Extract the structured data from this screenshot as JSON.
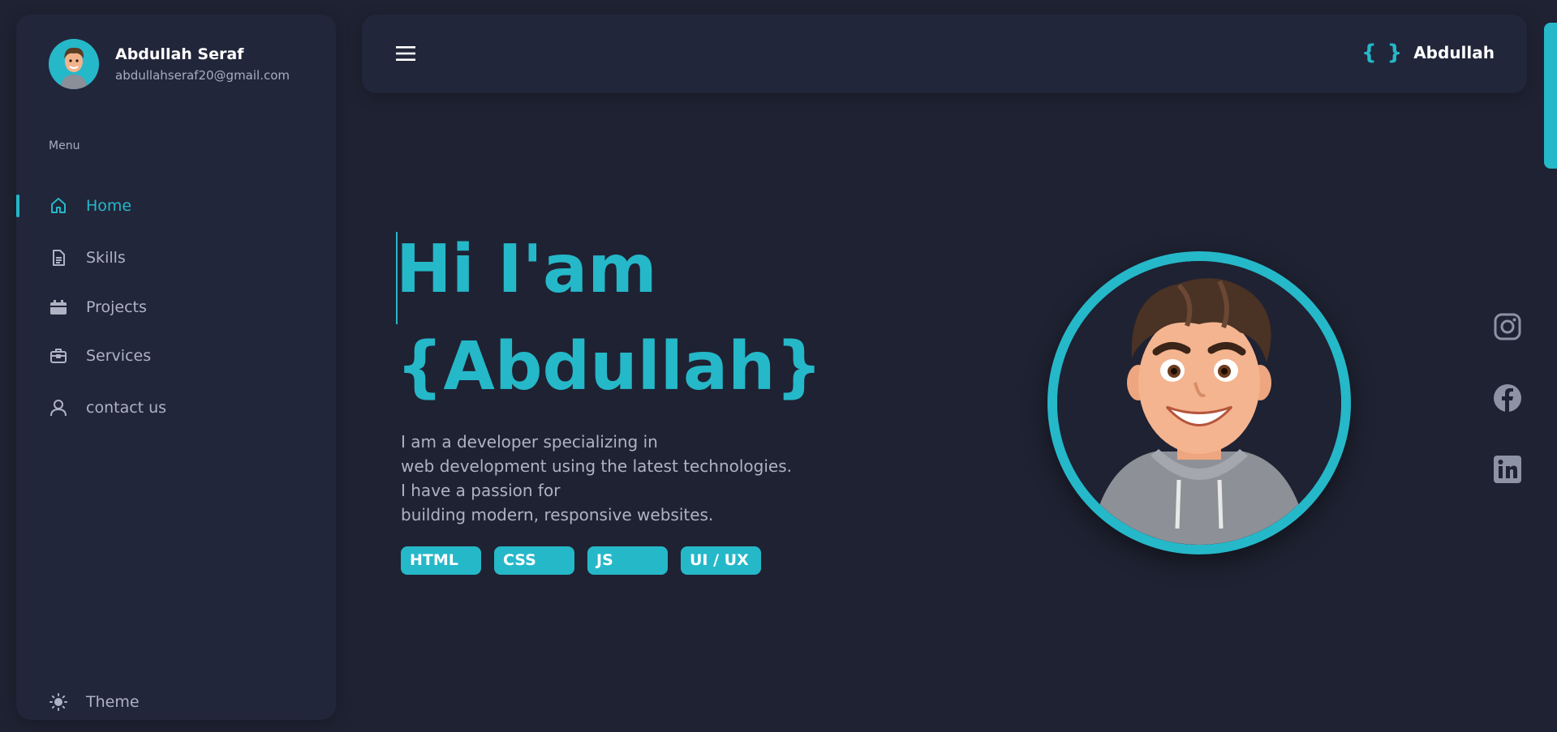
{
  "profile": {
    "name": "Abdullah Seraf",
    "email": "abdullahseraf20@gmail.com"
  },
  "sidebar": {
    "menu_label": "Menu",
    "items": [
      {
        "label": "Home",
        "icon": "home-icon",
        "active": true
      },
      {
        "label": "Skills",
        "icon": "document-icon"
      },
      {
        "label": "Projects",
        "icon": "calendar-icon"
      },
      {
        "label": "Services",
        "icon": "briefcase-icon"
      },
      {
        "label": "contact us",
        "icon": "user-icon"
      }
    ],
    "theme_label": "Theme"
  },
  "topbar": {
    "brand_icon": "{ }",
    "brand_name": "Abdullah"
  },
  "hero": {
    "greeting": "Hi I'am",
    "name": "{Abdullah}",
    "description": [
      "I am a developer specializing in",
      "web development using the latest technologies.",
      "I have a passion for",
      "building modern, responsive websites."
    ],
    "tags": [
      "HTML",
      "CSS",
      "JS",
      "UI / UX"
    ]
  },
  "social": [
    "instagram-icon",
    "facebook-icon",
    "linkedin-icon"
  ],
  "colors": {
    "accent": "#25b8c9",
    "background": "#1f2232",
    "panel": "#22263a",
    "muted_text": "#aeb3c4"
  }
}
